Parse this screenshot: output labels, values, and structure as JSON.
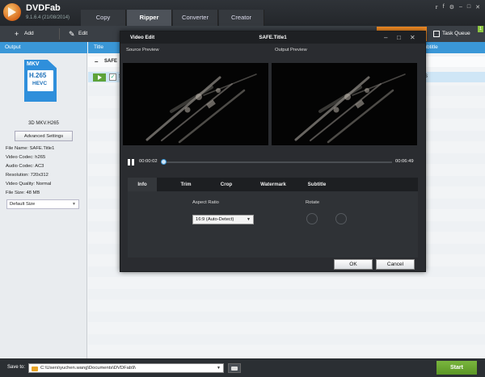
{
  "app": {
    "name": "DVDFab",
    "version": "9.1.6.4 (21/08/2014)"
  },
  "main_tabs": [
    {
      "label": "Copy"
    },
    {
      "label": "Ripper"
    },
    {
      "label": "Converter"
    },
    {
      "label": "Creator"
    }
  ],
  "window_icons": [
    "twitter-icon",
    "facebook-icon",
    "settings-icon",
    "minimize-icon",
    "maximize-icon",
    "close-icon"
  ],
  "toolbar": {
    "add_label": "Add",
    "edit_label": "Edit",
    "task_queue_label": "Task Queue",
    "task_badge": "1"
  },
  "columns": {
    "output": "Output",
    "title": "Title",
    "subtitle": "Subtitle"
  },
  "profile": {
    "badge_top": "MKV",
    "badge_codec": "H.265",
    "badge_sub": "HEVC",
    "name": "3D MKV.H265",
    "advanced_button": "Advanced Settings",
    "info": [
      "File Name: SAFE.Title1",
      "Video Codec: h265",
      "Audio Codec: AC3",
      "Resolution: 720x312",
      "Video Quality: Normal",
      "File Size: 48 MB"
    ],
    "size_option": "Default Size"
  },
  "list": {
    "group_title": "SAFE",
    "selected_row_letter": "S",
    "selected_row_subtitle": "ES"
  },
  "bottom": {
    "save_to_label": "Save to:",
    "save_path": "C:\\Users\\yuchen.wang\\Documents\\DVDFab9\\",
    "start_label": "Start"
  },
  "video_edit": {
    "header_left": "Video Edit",
    "header_center": "SAFE.Title1",
    "source_label": "Source Preview",
    "output_label": "Output Preview",
    "time_current": "00:00:02",
    "time_total": "00:06:49",
    "position_fraction": 0.005,
    "tabs": [
      "Info",
      "Trim",
      "Crop",
      "Watermark",
      "Subtitle"
    ],
    "active_tab": "Info",
    "aspect_ratio_label": "Aspect Ratio",
    "aspect_ratio_value": "16:9 (Auto-Detect)",
    "rotate_label": "Rotate",
    "ok_label": "OK",
    "cancel_label": "Cancel"
  },
  "colors": {
    "accent_blue": "#3a97d7",
    "start_green": "#6aa531",
    "orange": "#f08a24",
    "dark": "#2a2c30"
  }
}
